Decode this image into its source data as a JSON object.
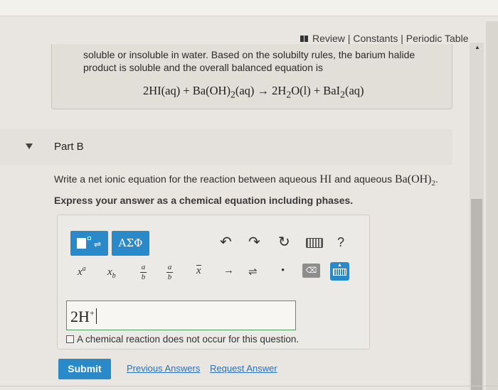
{
  "header": {
    "links": [
      "Review",
      "Constants",
      "Periodic Table"
    ],
    "separator": " | "
  },
  "answer_panel": {
    "text": "soluble or insoluble in water. Based on the solubilty rules, the barium halide product is soluble and the overall balanced equation is",
    "equation": {
      "reactant1": "2HI(aq)",
      "plus1": " + ",
      "reactant2_pre": "Ba(OH)",
      "reactant2_sub": "2",
      "reactant2_post": "(aq)",
      "arrow": " → ",
      "product1_pre": "2H",
      "product1_sub": "2",
      "product1_post": "O(l)",
      "plus2": " + ",
      "product2_pre": "BaI",
      "product2_sub": "2",
      "product2_post": "(aq)"
    }
  },
  "part": {
    "title": "Part B"
  },
  "question": {
    "prefix": "Write a net ionic equation for the reaction between aqueous ",
    "species1": "HI",
    "middle": " and aqueous ",
    "species2_pre": "Ba(OH)",
    "species2_sub": "2",
    "suffix": ".",
    "instruction": "Express your answer as a chemical equation including phases."
  },
  "editor": {
    "greek_label": "ΑΣΦ",
    "help_label": "?",
    "toolbar_row2": {
      "superscript_base": "x",
      "superscript_exp": "a",
      "subscript_base": "x",
      "subscript_sub": "b",
      "fraction_num": "a",
      "fraction_den": "b",
      "fraction2_num": "a",
      "fraction2_den": "b",
      "vector": "x",
      "arrow": "→",
      "equilibrium": "⇌",
      "dot": "•",
      "delete": "⌫"
    },
    "input": {
      "base": "2H",
      "sup": "+"
    },
    "no_reaction_label": "A chemical reaction does not occur for this question."
  },
  "actions": {
    "submit": "Submit",
    "previous_answers": "Previous Answers",
    "request_answer": "Request Answer"
  }
}
